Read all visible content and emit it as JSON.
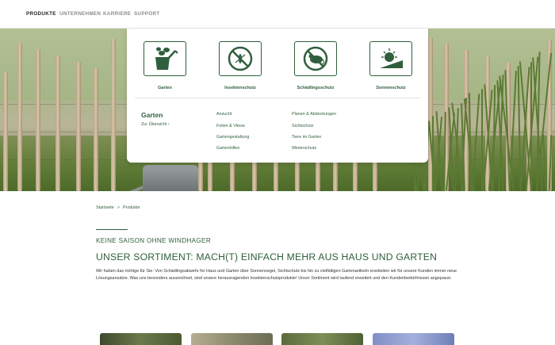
{
  "nav": {
    "items": [
      {
        "label": "PRODUKTE",
        "active": true
      },
      {
        "label": "UNTERNEHMEN",
        "active": false
      },
      {
        "label": "KARRIERE",
        "active": false
      },
      {
        "label": "SUPPORT",
        "active": false
      }
    ]
  },
  "mega_menu": {
    "categories": [
      {
        "label": "Garten",
        "icon": "garden-plant-icon"
      },
      {
        "label": "Insektenschutz",
        "icon": "no-mosquito-icon"
      },
      {
        "label": "Schädlingsschutz",
        "icon": "no-mouse-icon"
      },
      {
        "label": "Sonnenschutz",
        "icon": "sun-shade-icon"
      }
    ],
    "section_title": "Garten",
    "overview_link": "Zur Übersicht",
    "subcategories_col1": [
      "Anzucht",
      "Folien & Vliese",
      "Gartengestaltung",
      "Gartenhilfen"
    ],
    "subcategories_col2": [
      "Planen & Abdeckungen",
      "Sichtschutz",
      "Tiere im Garten",
      "Winterschutz"
    ]
  },
  "breadcrumb": {
    "home": "Startseite",
    "separator": ">",
    "current": "Produkte"
  },
  "content": {
    "kicker": "KEINE SAISON OHNE WINDHAGER",
    "headline": "UNSER SORTIMENT: MACH(T) EINFACH MEHR AUS HAUS UND GARTEN",
    "body": "Wir haben das richtige für Sie: Von Schädlingsabwehr für Haus und Garten über Sonnensegel, Sichtschutz bis hin zu vielfältigen Gartenartikeln erarbeiten wir für unsere Kunden immer neue Lösungsansätze. Was uns besonders auszeichnet, sind unsere herausragenden Insektenschutzprodukte! Unser Sortiment wird laufend erweitert und den Kundenbedürfnissen angepasst."
  },
  "colors": {
    "brand_green": "#2f5f3d",
    "nav_inactive": "#8c8c8c"
  }
}
